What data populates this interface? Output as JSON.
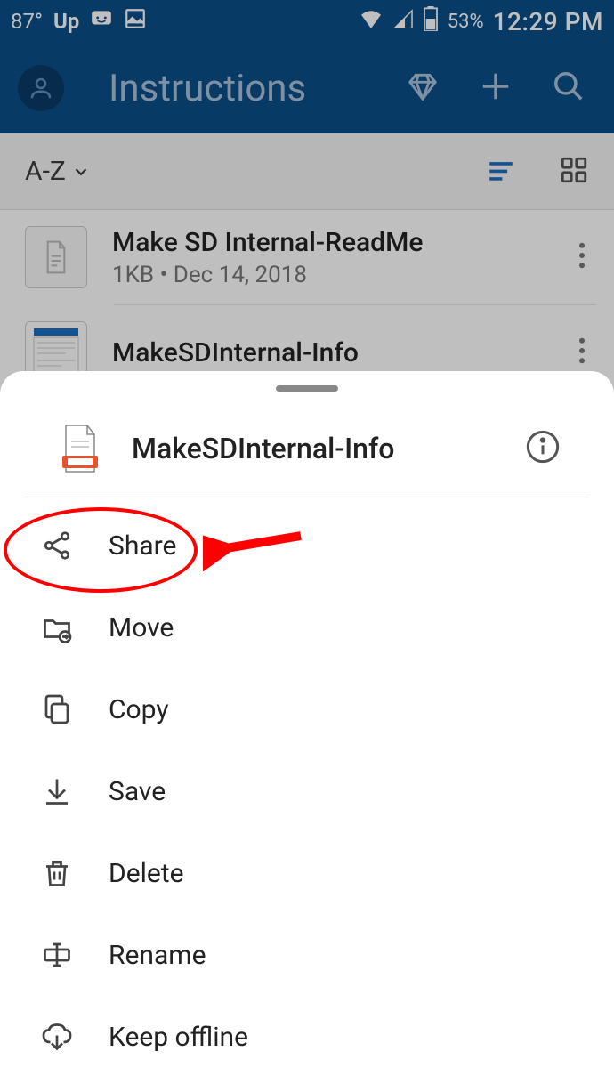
{
  "status": {
    "temperature": "87°",
    "battery_percent": "53%",
    "time": "12:29 PM"
  },
  "header": {
    "title": "Instructions"
  },
  "sort": {
    "label": "A-Z"
  },
  "files": [
    {
      "name": "Make SD Internal-ReadMe",
      "meta": "1KB • Dec 14, 2018"
    },
    {
      "name": "MakeSDInternal-Info",
      "meta": ""
    }
  ],
  "sheet": {
    "file_name": "MakeSDInternal-Info",
    "menu": [
      {
        "label": "Share",
        "icon": "share-icon"
      },
      {
        "label": "Move",
        "icon": "move-icon"
      },
      {
        "label": "Copy",
        "icon": "copy-icon"
      },
      {
        "label": "Save",
        "icon": "save-icon"
      },
      {
        "label": "Delete",
        "icon": "delete-icon"
      },
      {
        "label": "Rename",
        "icon": "rename-icon"
      },
      {
        "label": "Keep offline",
        "icon": "offline-icon"
      }
    ]
  }
}
